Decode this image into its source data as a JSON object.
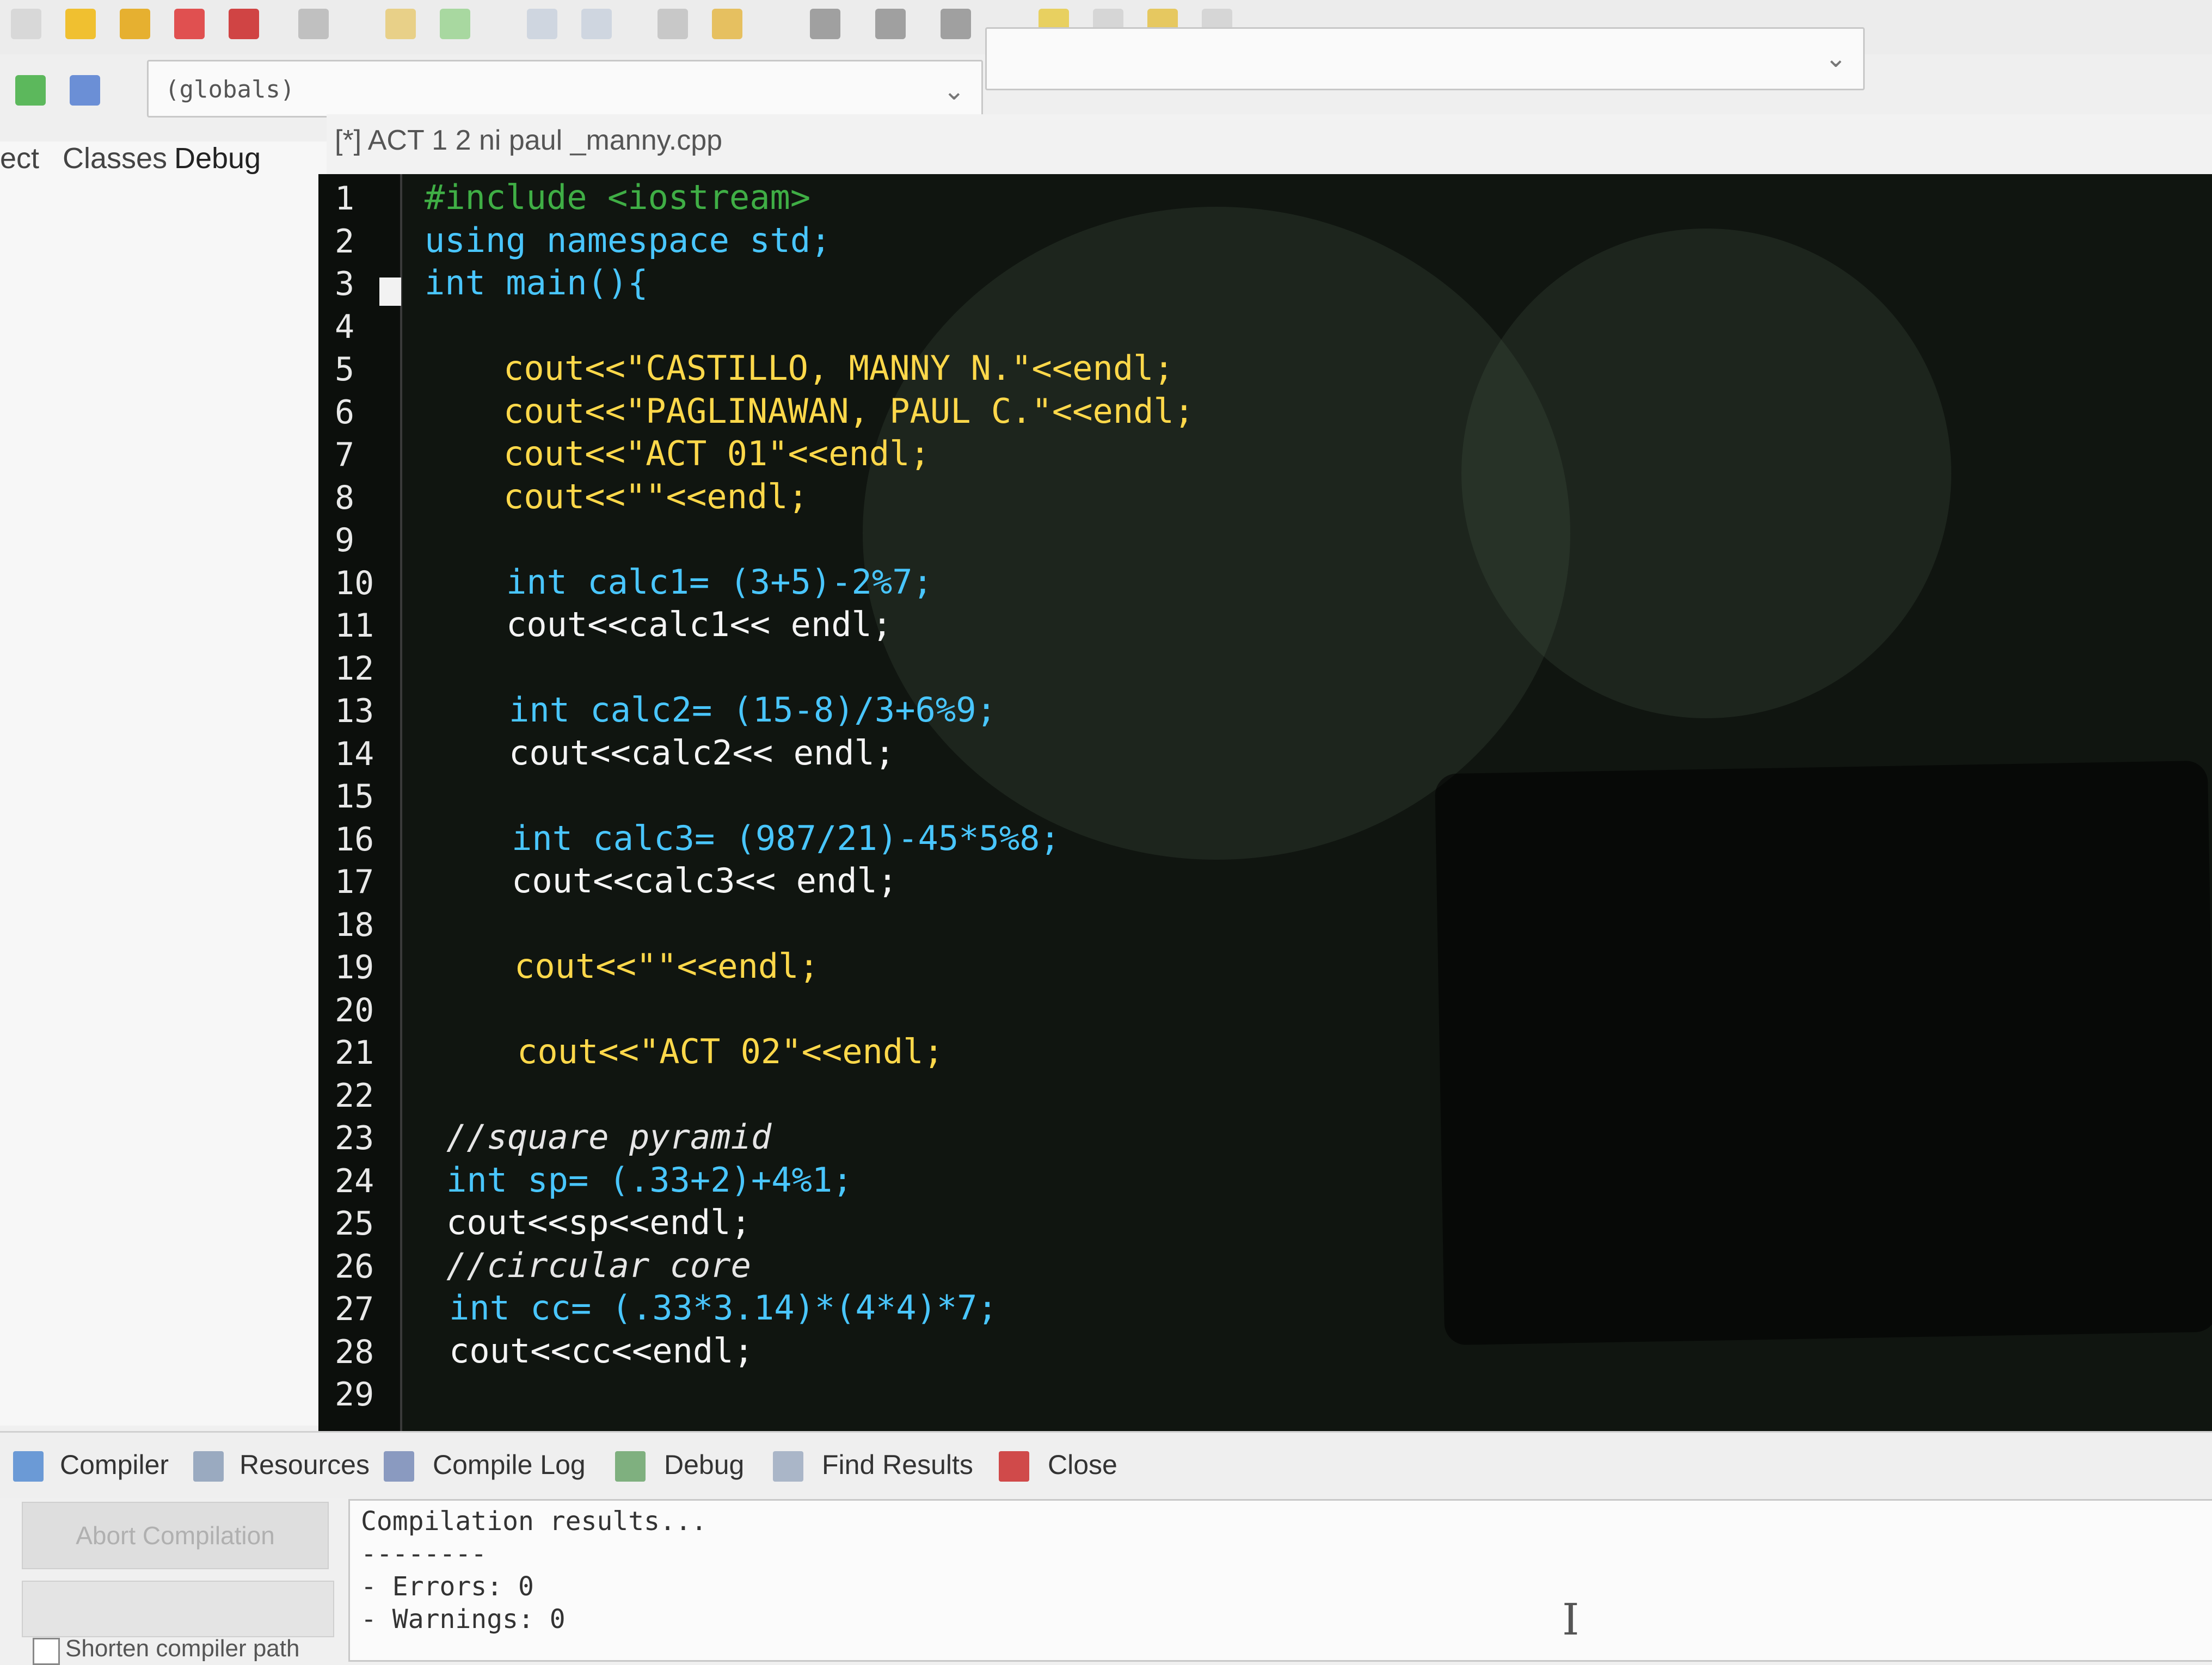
{
  "toolbar": {
    "globals_combo": "(globals)"
  },
  "left_panel": {
    "tabs": [
      "ect",
      "Classes",
      "Debug"
    ]
  },
  "editor": {
    "file_tab": "[*] ACT 1  2 ni paul _manny.cpp",
    "line_numbers": [
      "1",
      "2",
      "3",
      "4",
      "5",
      "6",
      "7",
      "8",
      "9",
      "10",
      "11",
      "12",
      "13",
      "14",
      "15",
      "16",
      "17",
      "18",
      "19",
      "20",
      "21",
      "22",
      "23",
      "24",
      "25",
      "26",
      "27",
      "28",
      "29"
    ],
    "lines": [
      "#include <iostream>",
      "using namespace std;",
      "int main(){",
      "",
      "cout<<\"CASTILLO, MANNY N.\"<<endl;",
      "cout<<\"PAGLINAWAN, PAUL C.\"<<endl;",
      "cout<<\"ACT 01\"<<endl;",
      "cout<<\"\"<<endl;",
      "",
      "int calc1= (3+5)-2%7;",
      "cout<<calc1<< endl;",
      "",
      "int calc2= (15-8)/3+6%9;",
      "cout<<calc2<< endl;",
      "",
      "int calc3= (987/21)-45*5%8;",
      "cout<<calc3<< endl;",
      "",
      "cout<<\"\"<<endl;",
      "",
      "cout<<\"ACT 02\"<<endl;",
      "",
      "//square pyramid",
      "int sp= (.33+2)+4%1;",
      "cout<<sp<<endl;",
      "//circular core",
      "int cc= (.33*3.14)*(4*4)*7;",
      "cout<<cc<<endl;",
      ""
    ]
  },
  "bottom_panel": {
    "tabs": [
      "Compiler",
      "Resources",
      "Compile Log",
      "Debug",
      "Find Results",
      "Close"
    ],
    "abort_button": "Abort Compilation",
    "output": [
      "Compilation results...",
      "--------",
      "- Errors: 0",
      "- Warnings: 0"
    ],
    "shorten_label": "Shorten compiler path"
  },
  "colors": {
    "keyword": "#49c6ff",
    "preprocessor": "#3fae45",
    "string": "#ffd84a",
    "number": "#ff4fe0",
    "editor_bg": "#101510"
  }
}
